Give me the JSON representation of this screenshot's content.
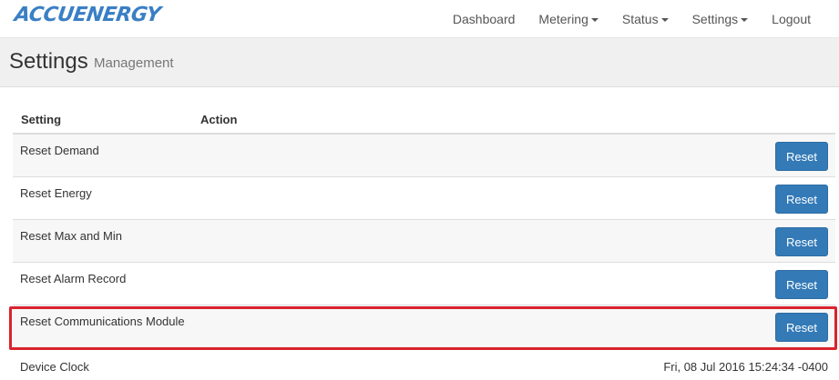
{
  "brand": {
    "logo_text": "ACCUENERGY",
    "color": "#3a7fc4"
  },
  "nav": {
    "items": [
      {
        "label": "Dashboard",
        "dropdown": false
      },
      {
        "label": "Metering",
        "dropdown": true
      },
      {
        "label": "Status",
        "dropdown": true
      },
      {
        "label": "Settings",
        "dropdown": true
      },
      {
        "label": "Logout",
        "dropdown": false
      }
    ]
  },
  "header": {
    "title": "Settings",
    "subtitle": "Management"
  },
  "table": {
    "columns": [
      "Setting",
      "Action"
    ],
    "rows": [
      {
        "label": "Reset Demand",
        "action": "Reset"
      },
      {
        "label": "Reset Energy",
        "action": "Reset"
      },
      {
        "label": "Reset Max and Min",
        "action": "Reset"
      },
      {
        "label": "Reset Alarm Record",
        "action": "Reset"
      },
      {
        "label": "Reset Communications Module",
        "action": "Reset",
        "highlighted": true
      }
    ]
  },
  "device_clock": {
    "label": "Device Clock",
    "value": "Fri, 08 Jul 2016 15:24:34 -0400"
  },
  "colors": {
    "primary_button": "#337ab7",
    "highlight_border": "#d9232e"
  }
}
